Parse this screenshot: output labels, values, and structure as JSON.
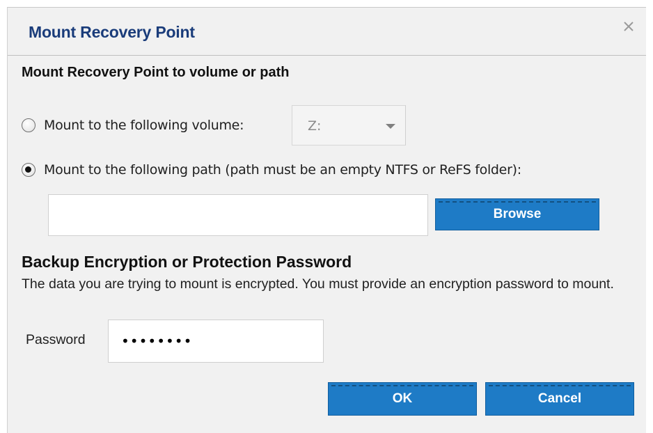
{
  "dialog": {
    "title": "Mount Recovery Point",
    "close_icon": "close-icon"
  },
  "mount_section": {
    "heading": "Mount Recovery Point to volume or path",
    "option_volume": {
      "label": "Mount to the following volume:",
      "checked": false,
      "selected_volume": "Z:"
    },
    "option_path": {
      "label": "Mount to the following path (path must be an empty NTFS or ReFS folder):",
      "checked": true,
      "path_value": ""
    },
    "browse_label": "Browse"
  },
  "encryption": {
    "heading": "Backup Encryption or Protection Password",
    "description": "The data you are trying to mount is encrypted. You must provide an encryption password to mount.",
    "password_label": "Password",
    "password_value": "secret12"
  },
  "buttons": {
    "ok_label": "OK",
    "cancel_label": "Cancel"
  },
  "colors": {
    "title_text": "#1a3c7a",
    "button_bg": "#1e7bc6",
    "dialog_bg": "#f1f1f1"
  }
}
